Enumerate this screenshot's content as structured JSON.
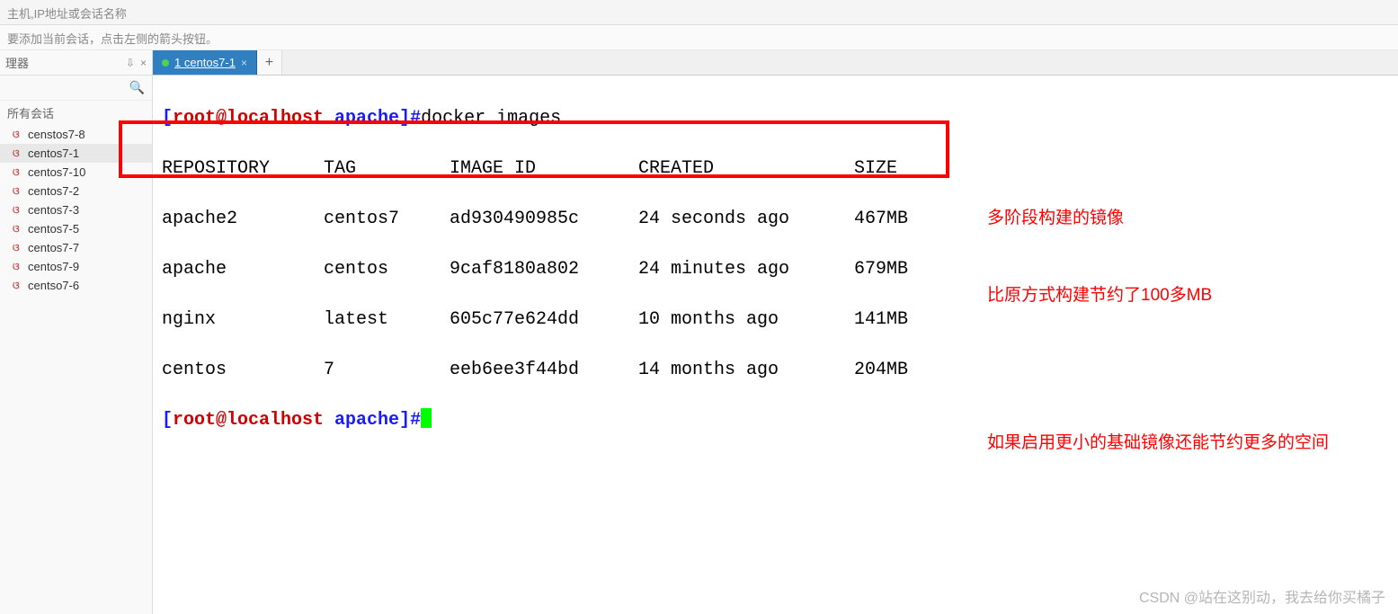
{
  "topbar": {
    "placeholder": "主机,IP地址或会话名称"
  },
  "hintbar": {
    "text": "要添加当前会话，点击左侧的箭头按钮。"
  },
  "sidebar": {
    "header": "理器",
    "sessions_label": "所有会话",
    "items": [
      {
        "name": "censtos7-8"
      },
      {
        "name": "centos7-1"
      },
      {
        "name": "centos7-10"
      },
      {
        "name": "centos7-2"
      },
      {
        "name": "centos7-3"
      },
      {
        "name": "centos7-5"
      },
      {
        "name": "centos7-7"
      },
      {
        "name": "centos7-9"
      },
      {
        "name": "centso7-6"
      }
    ],
    "active_index": 1
  },
  "tabs": {
    "items": [
      {
        "label": "1 centos7-1"
      }
    ],
    "add": "+"
  },
  "terminal": {
    "prompt_open": "[",
    "prompt_user": "root@localhost",
    "prompt_path": " apache",
    "prompt_close": "]#",
    "command": "docker images",
    "headers": {
      "repo": "REPOSITORY",
      "tag": "TAG",
      "imgid": "IMAGE ID",
      "created": "CREATED",
      "size": "SIZE"
    },
    "rows": [
      {
        "repo": "apache2",
        "tag": "centos7",
        "imgid": "ad930490985c",
        "created": "24 seconds ago",
        "size": "467MB"
      },
      {
        "repo": "apache",
        "tag": "centos",
        "imgid": "9caf8180a802",
        "created": "24 minutes ago",
        "size": "679MB"
      },
      {
        "repo": "nginx",
        "tag": "latest",
        "imgid": "605c77e624dd",
        "created": "10 months ago",
        "size": "141MB"
      },
      {
        "repo": "centos",
        "tag": "7",
        "imgid": "eeb6ee3f44bd",
        "created": "14 months ago",
        "size": "204MB"
      }
    ]
  },
  "annotations": {
    "line1": "多阶段构建的镜像",
    "line2": "比原方式构建节约了100多MB",
    "line3": "如果启用更小的基础镜像还能节约更多的空间"
  },
  "watermark": "CSDN @站在这别动，我去给你买橘子"
}
